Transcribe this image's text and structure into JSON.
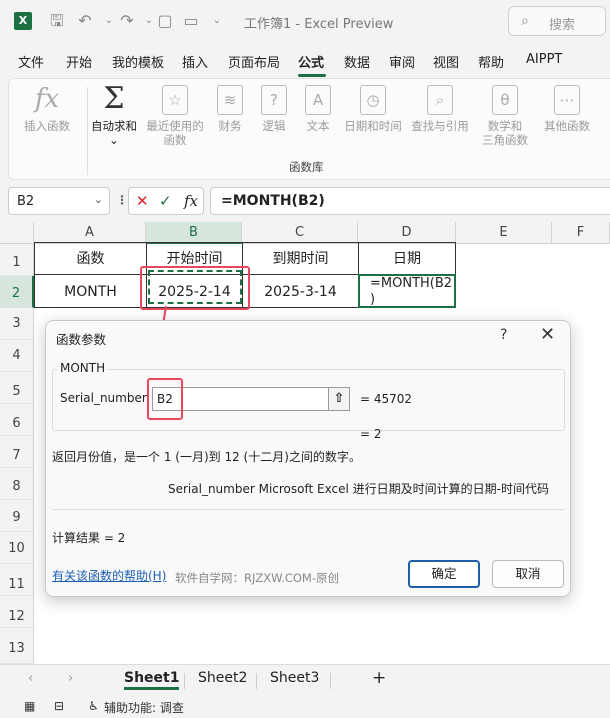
{
  "titlebar": {
    "title": "工作簿1 - Excel Preview",
    "search_placeholder": "搜索",
    "icons": [
      "excel-logo",
      "save-icon",
      "undo-icon",
      "redo-icon",
      "new-file-icon",
      "open-folder-icon",
      "more-icon"
    ]
  },
  "menu": {
    "tabs": [
      "文件",
      "开始",
      "我的模板",
      "插入",
      "页面布局",
      "公式",
      "数据",
      "审阅",
      "视图",
      "帮助",
      "AIPPT"
    ],
    "active": "公式"
  },
  "ribbon": {
    "buttons": [
      {
        "label": "插入函数",
        "icon": "fx-icon"
      },
      {
        "label": "自动求和",
        "icon": "sigma-icon"
      },
      {
        "label": "最近使用的\n函数",
        "icon": "star-icon"
      },
      {
        "label": "财务",
        "icon": "database-icon"
      },
      {
        "label": "逻辑",
        "icon": "question-icon"
      },
      {
        "label": "文本",
        "icon": "text-icon"
      },
      {
        "label": "日期和时间",
        "icon": "clock-icon"
      },
      {
        "label": "查找与引用",
        "icon": "search-icon"
      },
      {
        "label": "数学和\n三角函数",
        "icon": "theta-icon"
      },
      {
        "label": "其他函数",
        "icon": "more-icon"
      }
    ],
    "group_label": "函数库"
  },
  "formula_bar": {
    "name_box": "B2",
    "fx": "fx",
    "formula": "=MONTH(B2)"
  },
  "grid": {
    "columns": [
      "A",
      "B",
      "C",
      "D",
      "E",
      "F"
    ],
    "rows": [
      "1",
      "2",
      "3",
      "4",
      "5",
      "6",
      "7",
      "8",
      "9",
      "10",
      "11",
      "12",
      "13"
    ],
    "headers": [
      "函数",
      "开始时间",
      "到期时间",
      "日期"
    ],
    "row2": [
      "MONTH",
      "2025-2-14",
      "2025-3-14",
      "=MONTH(B2\n)"
    ]
  },
  "dialog": {
    "title": "函数参数",
    "help": "?",
    "close": "✕",
    "function_name": "MONTH",
    "arg_label": "Serial_number",
    "arg_value": "B2",
    "arg_eval": "=  45702",
    "result_eval": "=  2",
    "description": "返回月份值，是一个 1 (一月)到 12 (十二月)之间的数字。",
    "arg_description": "Serial_number   Microsoft Excel 进行日期及时间计算的日期-时间代码",
    "result": "计算结果 =   2",
    "help_link": "有关该函数的帮助(H)",
    "watermark": "软件自学网：RJZXW.COM-原创",
    "ok": "确定",
    "cancel": "取消"
  },
  "sheets": {
    "tabs": [
      "Sheet1",
      "Sheet2",
      "Sheet3"
    ],
    "active": "Sheet1",
    "add": "+"
  },
  "status": {
    "accessibility": "辅助功能: 调查"
  },
  "colors": {
    "accent": "#1d7044",
    "highlight": "#e8495d",
    "link": "#1a5fb4"
  }
}
